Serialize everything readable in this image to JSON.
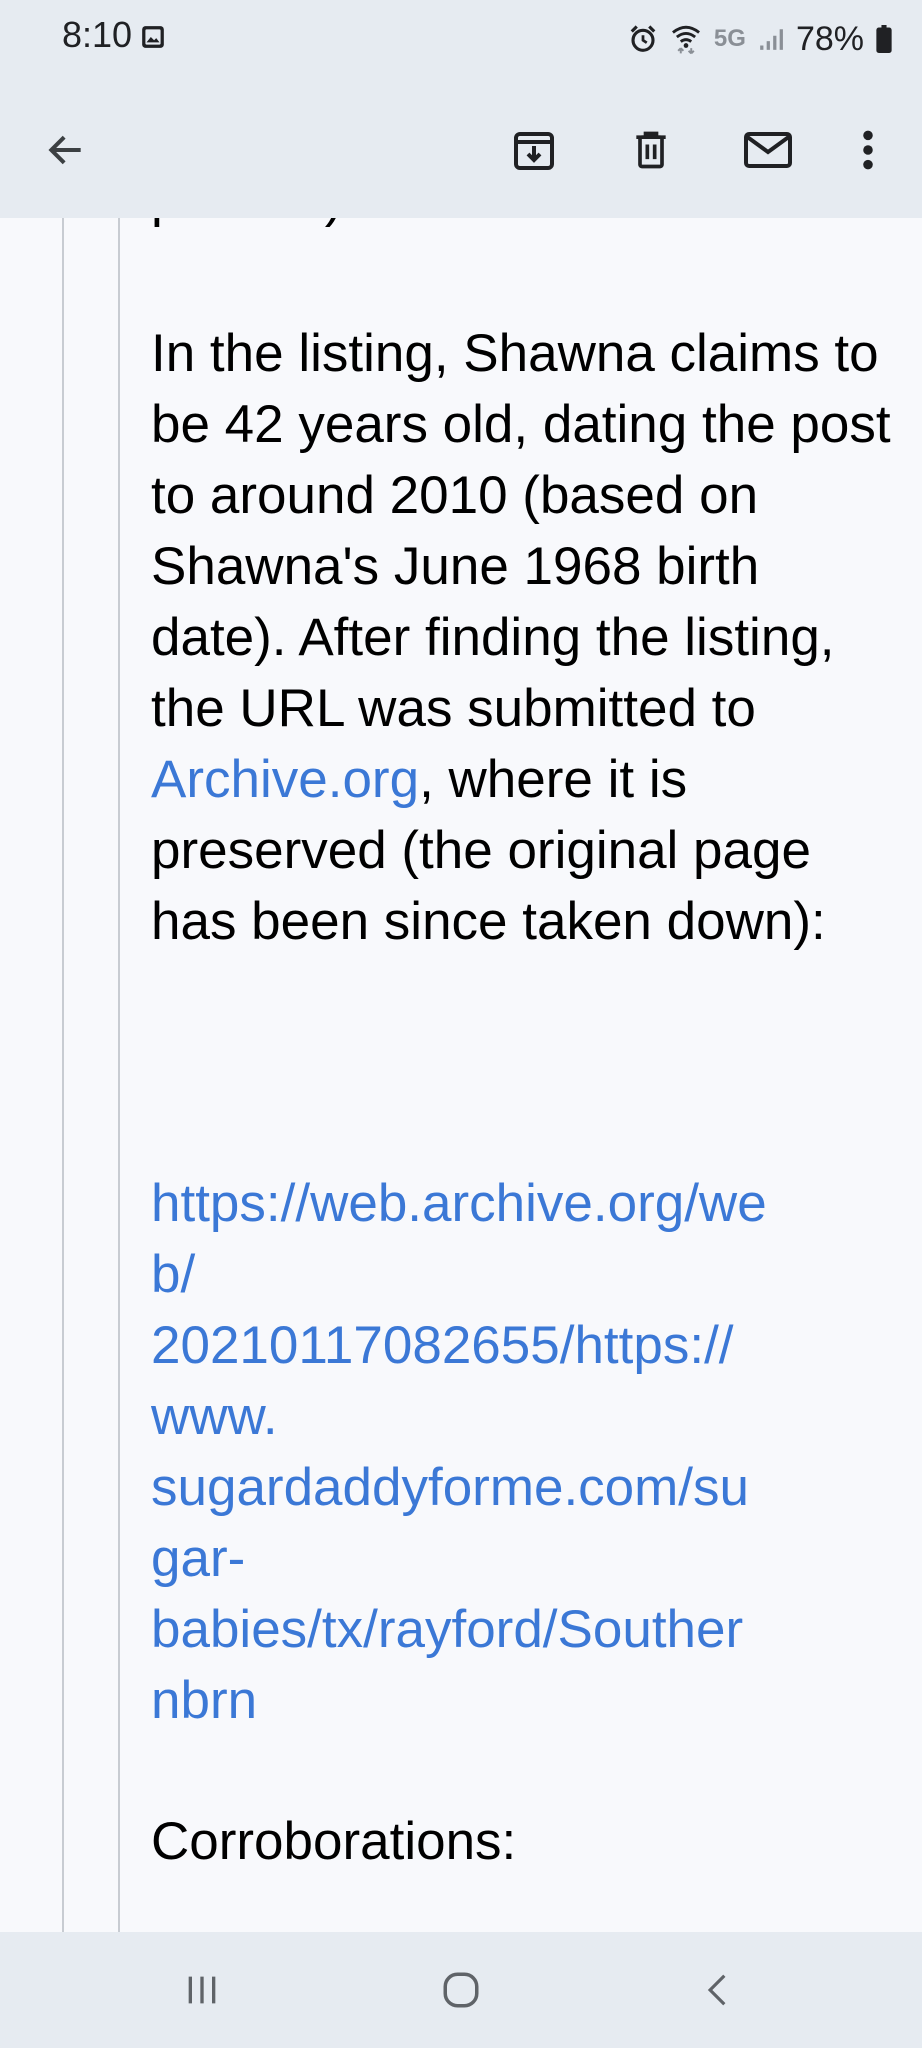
{
  "status_bar": {
    "time": "8:10",
    "network": "5G",
    "battery": "78%",
    "icons": [
      "gallery-icon",
      "alarm-icon",
      "wifi-icon",
      "signal-icon",
      "battery-icon"
    ]
  },
  "toolbar": {
    "icons": [
      "back-arrow-icon",
      "archive-icon",
      "delete-icon",
      "mail-unread-icon",
      "more-vert-icon"
    ]
  },
  "email": {
    "cut_off_text": "pervs!!!)",
    "paragraph1_intro": "In the listing, Shawna claims to be 42 years old, dating the post to around 2010 (based on Shawna's June 1968 birth date). After finding the listing, the URL was submitted to ",
    "archive_link": "Archive.org",
    "paragraph1_outro": ", where it is preserved (the original page has been since taken down):",
    "url_lines": [
      "https://web.archive.org/we",
      "b/",
      "20210117082655/https://",
      "www.",
      "sugardaddyforme.com/su",
      "gar-",
      "babies/tx/rayford/Souther",
      "nbrn"
    ],
    "corroborations": "Corroborations:"
  },
  "nav_bar": {
    "icons": [
      "recents-icon",
      "home-icon",
      "back-icon"
    ]
  },
  "colors": {
    "link": "#3b78d6",
    "bars": "#e6ebf1",
    "background": "#f8f9fc"
  }
}
